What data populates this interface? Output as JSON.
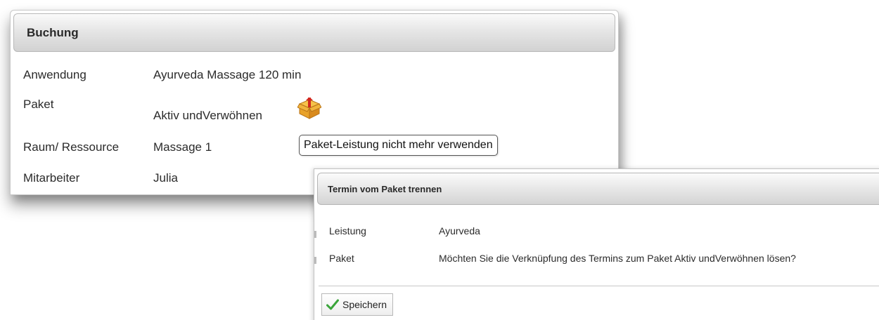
{
  "booking": {
    "title": "Buchung",
    "fields": [
      {
        "label": "Anwendung",
        "value": "Ayurveda Massage 120 min"
      },
      {
        "label": "Paket",
        "value": "Aktiv undVerwöhnen"
      },
      {
        "label": "Raum/ Ressource",
        "value": "Massage 1"
      },
      {
        "label": "Mitarbeiter",
        "value": "Julia"
      }
    ],
    "package_icon": "package-box-icon",
    "tooltip": "Paket-Leistung nicht mehr verwenden"
  },
  "dialog": {
    "title": "Termin vom Paket trennen",
    "rows": [
      {
        "label": "Leistung",
        "value": "Ayurveda"
      },
      {
        "label": "Paket",
        "value": "Möchten Sie die Verknüpfung des Termins zum Paket Aktiv undVerwöhnen lösen?"
      }
    ],
    "save_label": "Speichern",
    "save_icon": "checkmark-icon"
  },
  "colors": {
    "header_gradient_top": "#fafafa",
    "header_gradient_bottom": "#d2d2d2",
    "check_green": "#3aa53a",
    "box_orange": "#e8a22a",
    "box_red": "#d2281e"
  }
}
